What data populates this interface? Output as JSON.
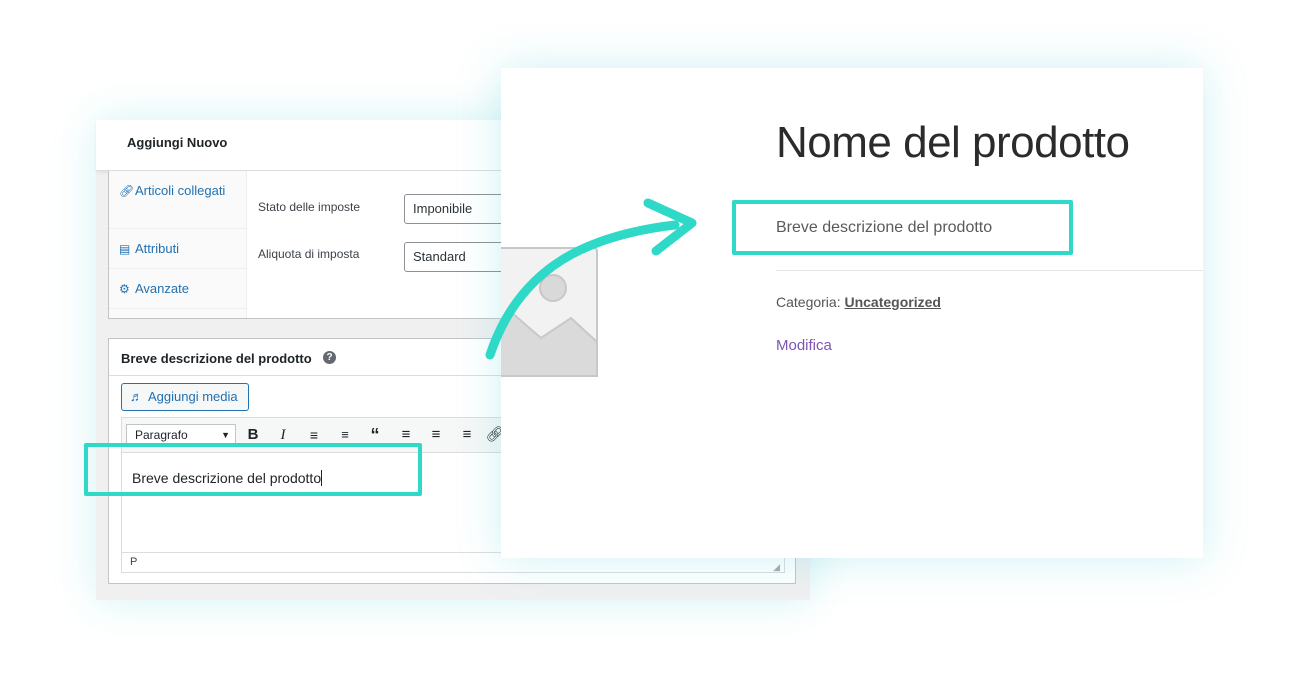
{
  "admin": {
    "header_title": "Aggiungi Nuovo",
    "product_data": {
      "tabs": [
        {
          "icon": "link-icon",
          "label": "Articoli collegati"
        },
        {
          "icon": "list-icon",
          "label": "Attributi"
        },
        {
          "icon": "gear-icon",
          "label": "Avanzate"
        }
      ],
      "fields": [
        {
          "label": "Stato delle imposte",
          "value": "Imponibile"
        },
        {
          "label": "Aliquota di imposta",
          "value": "Standard"
        }
      ]
    },
    "short_description": {
      "title": "Breve descrizione del prodotto",
      "help": "?",
      "add_media_label": "Aggiungi media",
      "format_select": "Paragrafo",
      "toolbar_buttons": [
        "bold",
        "italic",
        "bulleted-list",
        "numbered-list",
        "blockquote",
        "align-left",
        "align-center",
        "align-right",
        "link"
      ],
      "editor_text": "Breve descrizione del prodotto",
      "status_path": "P"
    }
  },
  "product_page": {
    "title": "Nome del prodotto",
    "short_description": "Breve descrizione del prodotto",
    "category_label": "Categoria:",
    "category_value": "Uncategorized",
    "edit_link": "Modifica"
  },
  "colors": {
    "highlight": "#2fd9c7",
    "wp_blue": "#2271b1",
    "edit_link": "#7f54b3"
  }
}
